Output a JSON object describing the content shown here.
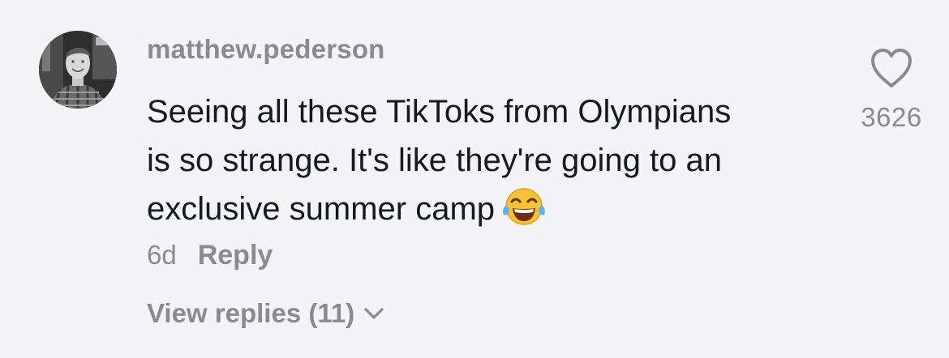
{
  "comment": {
    "username": "matthew.pederson",
    "text_lines": [
      "Seeing all these TikToks from Olympians",
      "is so strange. It's like they're going to an",
      "exclusive summer camp"
    ],
    "emoji": "😂",
    "timestamp": "6d",
    "reply_label": "Reply",
    "view_replies_label": "View replies (11)",
    "like_count": "3626"
  },
  "icons": {
    "like": "heart-outline-icon",
    "expand": "chevron-down-icon",
    "emoji": "face-with-tears-of-joy-icon"
  },
  "colors": {
    "background": "#f4f4f6",
    "primary_text": "#161823",
    "secondary_text": "#8a8b91"
  }
}
